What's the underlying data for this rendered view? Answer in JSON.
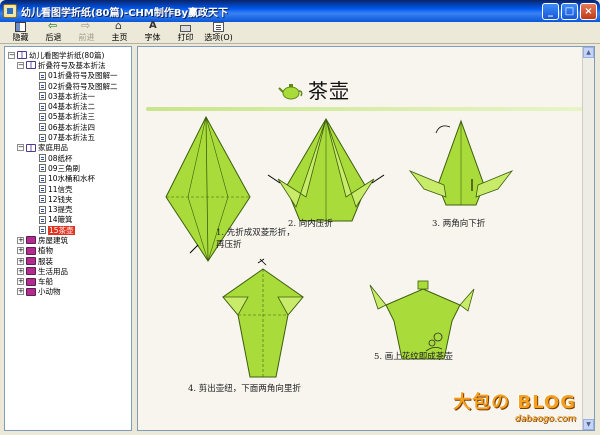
{
  "window": {
    "title": "幼儿看图学折纸(80篇)-CHM制作By赢政天下"
  },
  "toolbar": {
    "hide": "隐藏",
    "back": "后退",
    "forward": "前进",
    "home": "主页",
    "font": "字体",
    "print": "打印",
    "options": "选项(O)"
  },
  "tree": {
    "root": "幼儿看图学折纸(80篇)",
    "sections": [
      {
        "label": "折叠符号及基本折法",
        "expanded": true,
        "items": [
          "01折叠符号及图解一",
          "02折叠符号及图解二",
          "03基本折法一",
          "04基本折法二",
          "05基本折法三",
          "06基本折法四",
          "07基本折法五"
        ]
      },
      {
        "label": "家庭用品",
        "expanded": true,
        "items": [
          "08纸杯",
          "09三角刷",
          "10水桶和水杯",
          "11信壳",
          "12钱夹",
          "13提壳",
          "14簸箕",
          "15茶壶"
        ],
        "selected": "15茶壶"
      },
      {
        "label": "房屋建筑",
        "expanded": false
      },
      {
        "label": "植物",
        "expanded": false
      },
      {
        "label": "服装",
        "expanded": false
      },
      {
        "label": "生活用品",
        "expanded": false
      },
      {
        "label": "车船",
        "expanded": false
      },
      {
        "label": "小动物",
        "expanded": false
      }
    ]
  },
  "content": {
    "title": "茶壶",
    "steps": [
      "1. 先折成双菱形折，再压折",
      "2. 向内压折",
      "3. 两角向下折",
      "4. 剪出壶纽，下面两角向里折",
      "5. 画上花纹即成茶壶"
    ]
  },
  "watermark": {
    "brand": "大包の BLOG",
    "url": "dabaogo.com"
  },
  "colors": {
    "paper_green": "#a9dc3a",
    "paper_dark": "#5d8a12",
    "accent_bar": "#c8e68a"
  }
}
